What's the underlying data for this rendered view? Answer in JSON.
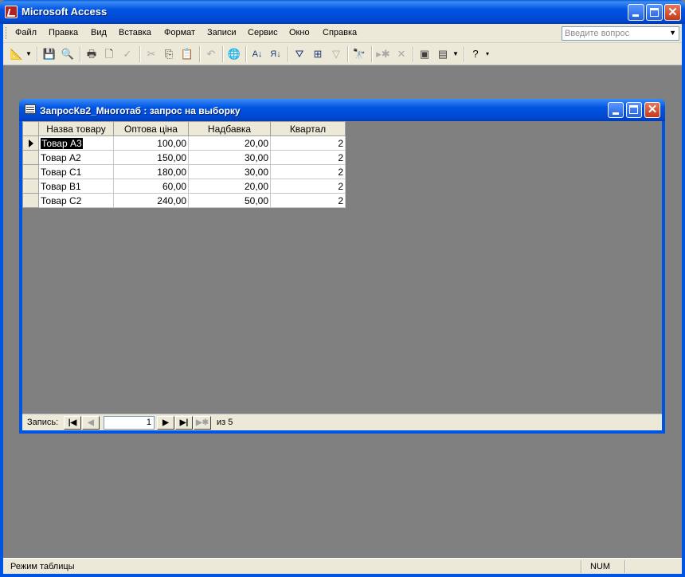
{
  "app": {
    "title": "Microsoft Access"
  },
  "menu": {
    "items": [
      "Файл",
      "Правка",
      "Вид",
      "Вставка",
      "Формат",
      "Записи",
      "Сервис",
      "Окно",
      "Справка"
    ],
    "help_placeholder": "Введите вопрос"
  },
  "toolbar": {
    "icons": [
      "design-view-icon",
      "dropdown-arrow-icon",
      "save-icon",
      "file-search-icon",
      "print-icon",
      "print-preview-icon",
      "spelling-icon",
      "cut-icon",
      "copy-icon",
      "paste-icon",
      "undo-icon",
      "hyperlink-icon",
      "sort-ascending-icon",
      "sort-descending-icon",
      "filter-by-selection-icon",
      "filter-by-form-icon",
      "apply-filter-icon",
      "find-icon",
      "new-record-icon",
      "delete-record-icon",
      "database-window-icon",
      "new-object-icon",
      "help-icon"
    ]
  },
  "query_window": {
    "title": "ЗапросКв2_Многотаб : запрос на выборку",
    "columns": [
      "Назва товару",
      "Оптова ціна",
      "Надбавка",
      "Квартал"
    ],
    "rows": [
      [
        "Товар А3",
        "100,00",
        "20,00",
        "2"
      ],
      [
        "Товар А2",
        "150,00",
        "30,00",
        "2"
      ],
      [
        "Товар С1",
        "180,00",
        "30,00",
        "2"
      ],
      [
        "Товар В1",
        "60,00",
        "20,00",
        "2"
      ],
      [
        "Товар С2",
        "240,00",
        "50,00",
        "2"
      ]
    ],
    "navigator": {
      "label": "Запись:",
      "current": "1",
      "total_text": "из  5"
    }
  },
  "status": {
    "mode": "Режим таблицы",
    "num": "NUM"
  }
}
